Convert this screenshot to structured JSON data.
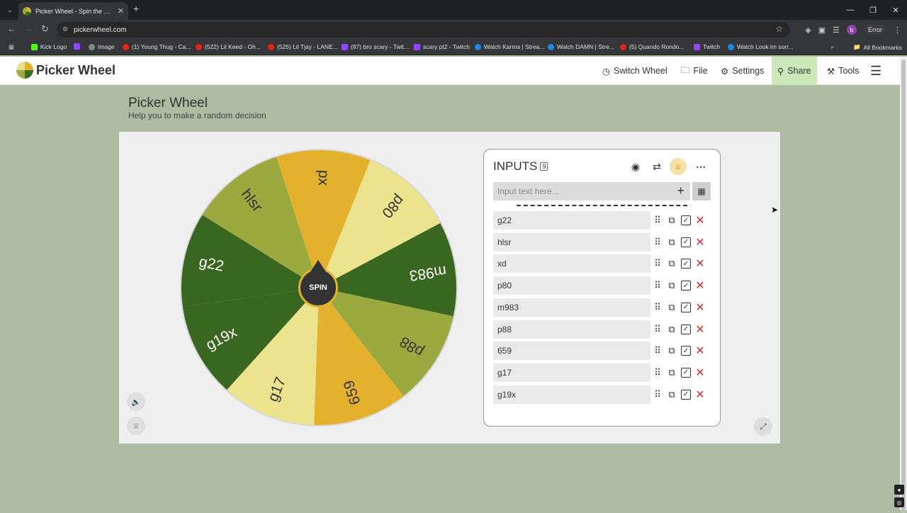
{
  "browser": {
    "tab_title": "Picker Wheel - Spin the Wheel",
    "url": "pickerwheel.com",
    "error_label": "Error",
    "profile_initial": "b",
    "bookmarks": [
      {
        "label": "Kick Logo",
        "color": "#53fc18"
      },
      {
        "label": "Image",
        "color": "#888888"
      },
      {
        "label": "(1) Young Thug - Ca...",
        "color": "#e62117"
      },
      {
        "label": "(522) Lil Keed - Oh...",
        "color": "#e62117"
      },
      {
        "label": "(525) Lil Tjay - LANE...",
        "color": "#e62117"
      },
      {
        "label": "(87) bro scary - Twit...",
        "color": "#9146ff"
      },
      {
        "label": "scary pt2 - Twitch",
        "color": "#9146ff"
      },
      {
        "label": "Watch Karma | Strea...",
        "color": "#1e88e5"
      },
      {
        "label": "Watch DAMN | Stre...",
        "color": "#1e88e5"
      },
      {
        "label": "(5) Quando Rondo...",
        "color": "#e62117"
      },
      {
        "label": "Twitch",
        "color": "#9146ff"
      },
      {
        "label": "Watch Look im sorr...",
        "color": "#1e88e5"
      }
    ],
    "all_bookmarks": "All Bookmarks"
  },
  "header": {
    "brand": "Picker Wheel",
    "menu": [
      {
        "label": "Switch Wheel",
        "icon": "clock-icon"
      },
      {
        "label": "File",
        "icon": "folder-icon"
      },
      {
        "label": "Settings",
        "icon": "gear-icon"
      },
      {
        "label": "Share",
        "icon": "share-icon"
      },
      {
        "label": "Tools",
        "icon": "wrench-icon"
      }
    ]
  },
  "page": {
    "title": "Picker Wheel",
    "subtitle": "Help you to make a random decision"
  },
  "wheel": {
    "spin_label": "SPIN",
    "segments": [
      {
        "label": "px",
        "color": "#e4b12f"
      },
      {
        "label": "p80",
        "color": "#ebe38e"
      },
      {
        "label": "m983",
        "color": "#396620"
      },
      {
        "label": "p88",
        "color": "#9aaa3f"
      },
      {
        "label": "659",
        "color": "#e4b12f"
      },
      {
        "label": "g17",
        "color": "#ebe38e"
      },
      {
        "label": "g19x",
        "color": "#396620"
      },
      {
        "label": "g22",
        "color": "#396620"
      },
      {
        "label": "hlsr",
        "color": "#9aaa3f"
      }
    ]
  },
  "inputs": {
    "title": "INPUTS",
    "count": "9",
    "placeholder": "Input text here...",
    "entries": [
      "g22",
      "hlsr",
      "xd",
      "p80",
      "m983",
      "p88",
      "659",
      "g17",
      "g19x"
    ]
  }
}
